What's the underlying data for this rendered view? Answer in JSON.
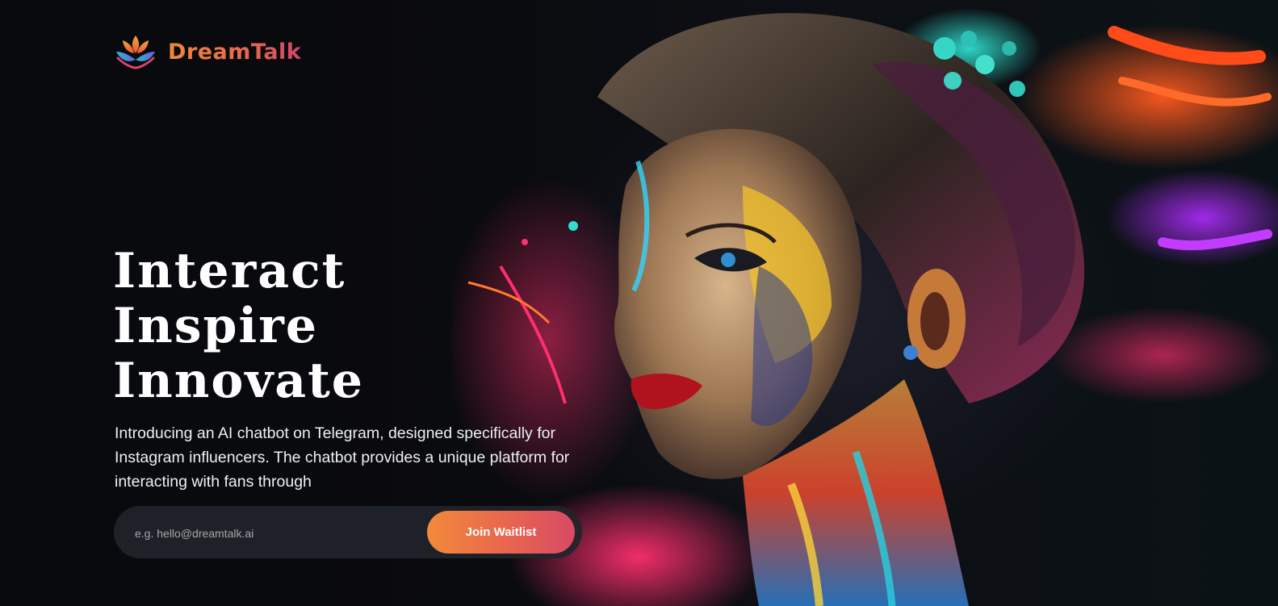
{
  "brand": {
    "name": "DreamTalk",
    "logo_icon": "lotus-icon",
    "gradient_start": "#f0873a",
    "gradient_end": "#d2466a"
  },
  "hero": {
    "headline_lines": [
      "Interact",
      "Inspire",
      "Innovate"
    ],
    "description": "Introducing an AI chatbot on Telegram, designed specifically for Instagram influencers. The chatbot provides a unique platform for interacting with fans through",
    "image": "colorful-painted-woman-portrait"
  },
  "waitlist": {
    "email_placeholder": "e.g. hello@dreamtalk.ai",
    "email_value": "",
    "button_label": "Join Waitlist",
    "button_gradient": [
      "#f3893a",
      "#d84a66"
    ]
  }
}
